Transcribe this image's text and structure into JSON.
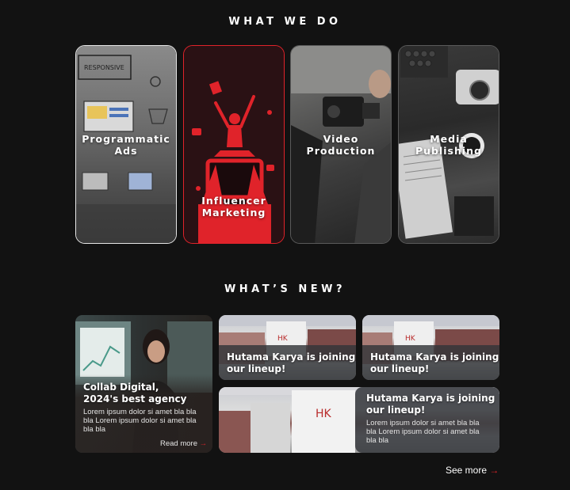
{
  "sections": {
    "what_we_do_title": "WHAT WE DO",
    "whats_new_title": "WHAT’S NEW?"
  },
  "services": [
    {
      "label": "Programmatic\nAds"
    },
    {
      "label": "Influencer\nMarketing"
    },
    {
      "label": "Video\nProduction"
    },
    {
      "label": "Media\nPublishing"
    }
  ],
  "news": {
    "featured": {
      "headline": "Collab Digital,\n2024's best agency",
      "body": "Lorem ipsum dolor si amet bla bla bla Lorem ipsum dolor si amet bla bla bla",
      "read_more": "Read more",
      "arrow": "→"
    },
    "items": [
      {
        "headline": "Hutama Karya is joining\nour lineup!"
      },
      {
        "headline": "Hutama Karya is joining\nour lineup!"
      },
      {
        "headline": "Hutama Karya is joining\nour lineup!",
        "body": "Lorem ipsum dolor si amet bla bla bla Lorem ipsum dolor si amet bla bla bla"
      }
    ],
    "building_sign": "HK"
  },
  "see_more": {
    "label": "See more",
    "arrow": "→"
  },
  "colors": {
    "accent": "#e0232a",
    "background": "#121212"
  }
}
